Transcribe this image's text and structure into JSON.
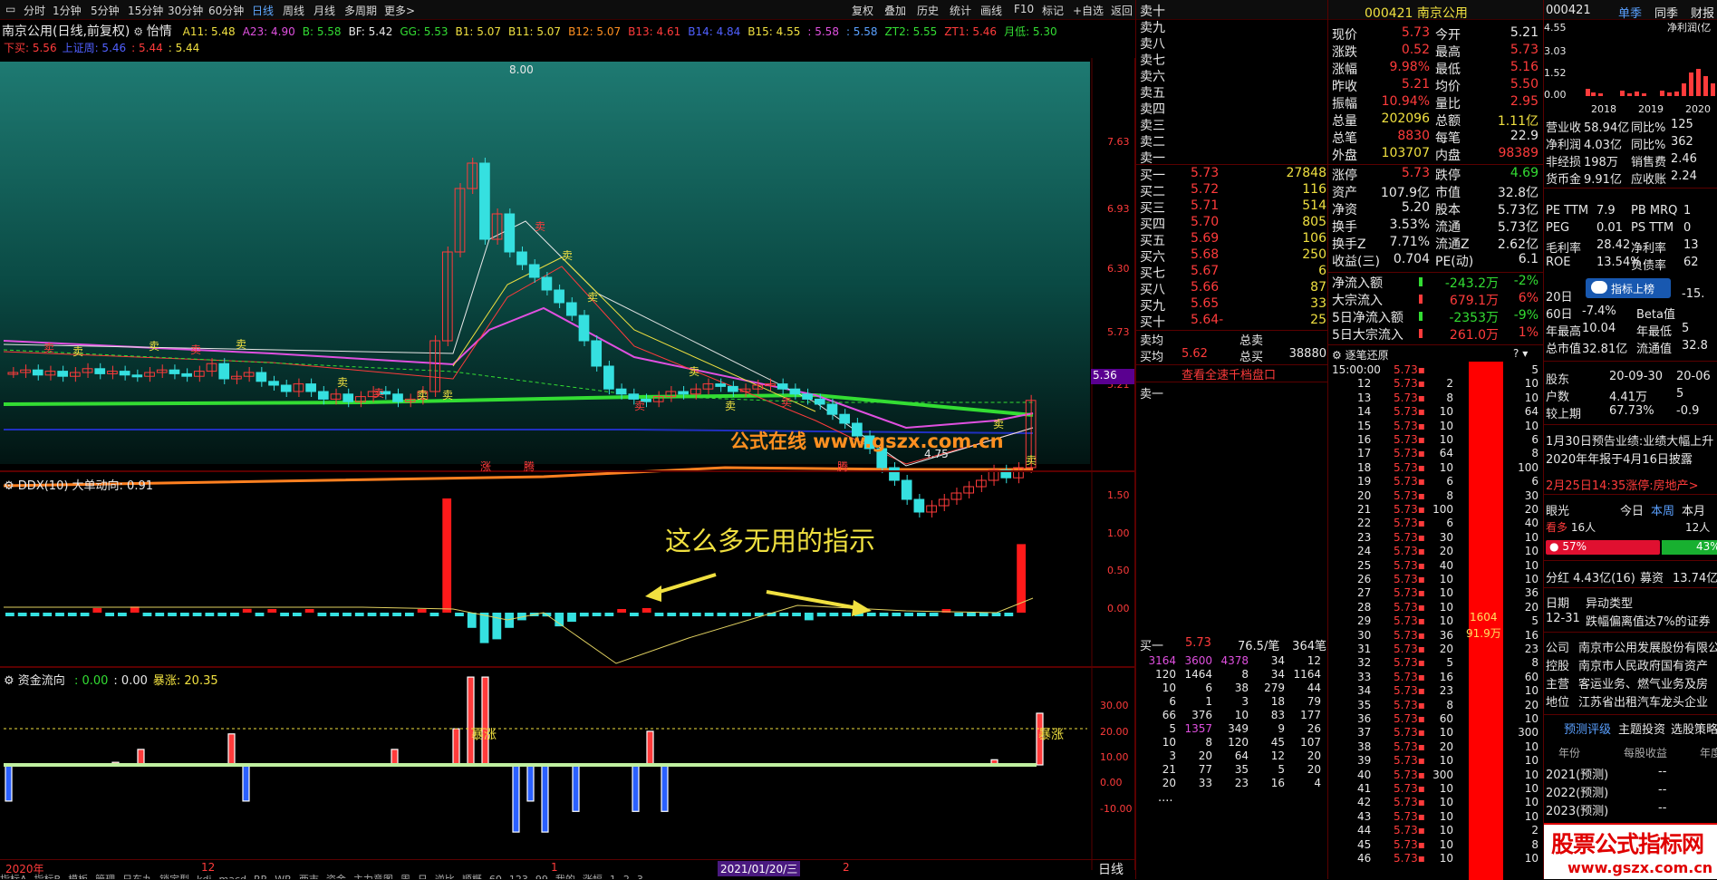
{
  "toolbar": {
    "items": [
      "分时",
      "1分钟",
      "5分钟",
      "15分钟",
      "30分钟",
      "60分钟",
      "日线",
      "周线",
      "月线",
      "多周期",
      "更多>"
    ],
    "active": "日线",
    "right": [
      "复权",
      "叠加",
      "历史",
      "统计",
      "画线",
      "F10",
      "标记",
      "+自选",
      "返回"
    ]
  },
  "chart": {
    "title": "南京公用(日线,前复权)",
    "ind_name": "怡情",
    "params": [
      {
        "t": "A11: 5.48",
        "c": "#f0e040"
      },
      {
        "t": "A23: 4.90",
        "c": "#e050e0"
      },
      {
        "t": "B: 5.58",
        "c": "#33dd33"
      },
      {
        "t": "BF: 5.42",
        "c": "#e8e8e8"
      },
      {
        "t": "GG: 5.53",
        "c": "#33dd33"
      },
      {
        "t": "B1: 5.07",
        "c": "#f0e040"
      },
      {
        "t": "B11: 5.07",
        "c": "#f0e040"
      },
      {
        "t": "B12: 5.07",
        "c": "#ff9020"
      },
      {
        "t": "B13: 4.61",
        "c": "#ff3b3b"
      },
      {
        "t": "B14: 4.84",
        "c": "#5060ff"
      },
      {
        "t": "B15: 4.55",
        "c": "#f0e040"
      },
      {
        "t": ": 5.58",
        "c": "#e050e0"
      },
      {
        "t": ": 5.58",
        "c": "#5aa0ff"
      },
      {
        "t": "ZT2: 5.55",
        "c": "#33dd33"
      },
      {
        "t": "ZT1: 5.46",
        "c": "#ff3b3b"
      },
      {
        "t": "月低: 5.30",
        "c": "#33dd33"
      }
    ],
    "line2": [
      {
        "t": "下买: 5.56",
        "c": "#ff3b3b"
      },
      {
        "t": "上证周: 5.46",
        "c": "#5060ff"
      },
      {
        "t": ": 5.44",
        "c": "#ff3b3b"
      },
      {
        "t": ": 5.44",
        "c": "#f0e040"
      }
    ],
    "yaxis": [
      "7.63",
      "6.93",
      "6.30",
      "5.73",
      "5.21"
    ],
    "current_price": "5.36",
    "high_label": "8.00",
    "low_label": "4.75",
    "watermark": "公式在线  www.gszx.com.cn",
    "bottom_marks": [
      "涨",
      "腾",
      "腾"
    ]
  },
  "ddx": {
    "title": "DDX(10) 大单动向: 0.91",
    "yaxis": [
      "1.50",
      "1.00",
      "0.50",
      "0.00"
    ],
    "annotation": "这么多无用的指示"
  },
  "fund": {
    "title": "资金流向",
    "vals": [
      {
        "t": ": 0.00",
        "c": "#33dd33"
      },
      {
        "t": ": 0.00",
        "c": "#e8e8e8"
      },
      {
        "t": "暴涨: 20.35",
        "c": "#f0e040"
      }
    ],
    "yaxis": [
      "30.00",
      "20.00",
      "10.00",
      "0.00",
      "-10.00"
    ],
    "label_baozhang": "暴涨"
  },
  "xaxis": {
    "labels": [
      "2020年",
      "12",
      "1",
      "2021/01/20/三",
      "2"
    ],
    "period": "日线"
  },
  "tabs": [
    "指标A",
    "指标B",
    "模板",
    "管理",
    "日东九",
    "锁定型",
    "kdj",
    "macd",
    "RR",
    "WR",
    "两市",
    "资金",
    "主力意图",
    "周",
    "日",
    "逆比",
    "顺概",
    "60",
    "123",
    "99",
    "我的",
    "涨幅",
    "1",
    "2",
    "3"
  ],
  "orderbook": {
    "sell": [
      "卖十",
      "卖九",
      "卖八",
      "卖七",
      "卖六",
      "卖五",
      "卖四",
      "卖三",
      "卖二",
      "卖一"
    ],
    "buy": [
      [
        "买一",
        "5.73",
        "27848"
      ],
      [
        "买二",
        "5.72",
        "116"
      ],
      [
        "买三",
        "5.71",
        "514"
      ],
      [
        "买四",
        "5.70",
        "805"
      ],
      [
        "买五",
        "5.69",
        "106"
      ],
      [
        "买六",
        "5.68",
        "250"
      ],
      [
        "买七",
        "5.67",
        "6"
      ],
      [
        "买八",
        "5.66",
        "87"
      ],
      [
        "买九",
        "5.65",
        "33"
      ],
      [
        "买十",
        "5.64-",
        "25"
      ]
    ],
    "avg_sell": "卖均",
    "total_sell": "总卖",
    "avg_buy": "买均",
    "avg_buy_val": "5.62",
    "total_buy": "总买",
    "total_buy_val": "38880",
    "link": "查看全速千档盘口",
    "sell1_label": "卖一",
    "buy1_row": [
      "买一",
      "5.73",
      "76.5/笔",
      "364笔"
    ],
    "queue": [
      [
        "3164",
        "3600",
        "4378",
        "34",
        "12"
      ],
      [
        "120",
        "1464",
        "8",
        "34",
        "1164"
      ],
      [
        "10",
        "6",
        "38",
        "279",
        "44"
      ],
      [
        "6",
        "1",
        "3",
        "18",
        "79"
      ],
      [
        "66",
        "376",
        "10",
        "83",
        "177"
      ],
      [
        "5",
        "1357",
        "349",
        "9",
        "26"
      ],
      [
        "10",
        "8",
        "120",
        "45",
        "107"
      ],
      [
        "3",
        "20",
        "64",
        "12",
        "20"
      ],
      [
        "21",
        "77",
        "35",
        "5",
        "20"
      ],
      [
        "20",
        "33",
        "23",
        "16",
        "4"
      ]
    ],
    "more": "...."
  },
  "quote": {
    "code": "000421",
    "name": "南京公用",
    "rows": [
      [
        "现价",
        "5.73",
        "今开",
        "5.21"
      ],
      [
        "涨跌",
        "0.52",
        "最高",
        "5.73"
      ],
      [
        "涨幅",
        "9.98%",
        "最低",
        "5.16"
      ],
      [
        "昨收",
        "5.21",
        "均价",
        "5.50"
      ],
      [
        "振幅",
        "10.94%",
        "量比",
        "2.95"
      ],
      [
        "总量",
        "202096",
        "总额",
        "1.11亿"
      ],
      [
        "总笔",
        "8830",
        "每笔",
        "22.9"
      ],
      [
        "外盘",
        "103707",
        "内盘",
        "98389"
      ]
    ],
    "rows2": [
      [
        "涨停",
        "5.73",
        "跌停",
        "4.69"
      ],
      [
        "资产",
        "107.9亿",
        "市值",
        "32.8亿"
      ],
      [
        "净资",
        "5.20",
        "股本",
        "5.73亿"
      ],
      [
        "换手",
        "3.53%",
        "流通",
        "5.73亿"
      ],
      [
        "换手Z",
        "7.71%",
        "流通Z",
        "2.62亿"
      ],
      [
        "收益(三)",
        "0.704",
        "PE(动)",
        "6.1"
      ]
    ],
    "flows": [
      [
        "净流入额",
        "-243.2万",
        "-2%"
      ],
      [
        "大宗流入",
        "679.1万",
        "6%"
      ],
      [
        "5日净流入额",
        "-2353万",
        "-9%"
      ],
      [
        "5日大宗流入",
        "261.0万",
        "1%"
      ]
    ]
  },
  "ticks": {
    "title": "逐笔还原",
    "q": "?",
    "start": "15:00:00",
    "mins": [
      "12",
      "13",
      "14",
      "15",
      "16",
      "17",
      "18",
      "19",
      "20",
      "21",
      "22",
      "23",
      "24",
      "25",
      "26",
      "27",
      "28",
      "29",
      "30",
      "31",
      "32",
      "33",
      "34",
      "35",
      "36",
      "37",
      "38",
      "39",
      "40",
      "41",
      "42",
      "43",
      "44",
      "45",
      "46"
    ],
    "vols": [
      "2",
      "8",
      "10",
      "10",
      "10",
      "64",
      "10",
      "6",
      "8",
      "100",
      "6",
      "30",
      "20",
      "40",
      "10",
      "10",
      "10",
      "10",
      "36",
      "20",
      "5",
      "16",
      "23",
      "8",
      "60",
      "10",
      "20",
      "10",
      "300",
      "10",
      "10",
      "10",
      "10",
      "10",
      "10"
    ],
    "vol_first": "5",
    "big_label": "1604",
    "big_label2": "91.9万",
    "price": "5.73"
  },
  "f10": {
    "code": "000421",
    "tabs": [
      "单季",
      "同季",
      "财报"
    ],
    "mini_chart": {
      "ylabels": [
        "4.55",
        "3.03",
        "1.52",
        "0.00"
      ],
      "years": [
        "2018",
        "2019",
        "2020"
      ],
      "legend": "净利润(亿"
    },
    "rows": [
      [
        "营业收",
        "58.94亿",
        "同比%",
        "125"
      ],
      [
        "净利润",
        "4.03亿",
        "同比%",
        "362"
      ],
      [
        "非经损",
        "198万",
        "销售费",
        "2.46"
      ],
      [
        "货币金",
        "9.91亿",
        "应收账",
        "2.24"
      ]
    ],
    "rows_b": [
      [
        "PE TTM",
        "7.9",
        "PB MRQ",
        "1"
      ],
      [
        "PEG",
        "0.01",
        "PS TTM",
        "0"
      ],
      [
        "毛利率",
        "28.42",
        "净利率",
        "13"
      ],
      [
        "ROE",
        "13.54%",
        "负债率",
        "62"
      ]
    ],
    "btn": "指标上榜",
    "rows_c": [
      [
        "20日",
        "",
        "",
        "-15."
      ],
      [
        "60日",
        "-7.4%",
        "Beta值",
        ""
      ],
      [
        "年最高",
        "10.04",
        "年最低",
        "5"
      ],
      [
        "总市值",
        "32.81亿",
        "流通值",
        "32.8"
      ]
    ],
    "rows_d": [
      [
        "股东",
        "20-09-30",
        "20-06"
      ],
      [
        "户数",
        "4.41万",
        "5"
      ],
      [
        "较上期",
        "67.73%",
        "-0.9"
      ]
    ],
    "news": [
      [
        "1月30日预告业绩:业绩大幅上升"
      ],
      [
        "2020年年报于4月16日披露"
      ]
    ],
    "news_red": "2月25日14:35涨停:房地产>",
    "sentiment": {
      "label": "眼光",
      "tabs": [
        "今日",
        "本周",
        "本月"
      ],
      "bull": "看多",
      "bull_n": "16人",
      "bear_n": "12人",
      "bull_pct": "57%",
      "bear_pct": "43%"
    },
    "div": [
      "分红",
      "4.43亿(16)",
      "募资",
      "13.74亿"
    ],
    "event": [
      "日期",
      "异动类型"
    ],
    "event_row": [
      "12-31",
      "跌幅偏离值达7%的证券"
    ],
    "info": [
      [
        "公司",
        "南京市公用发展股份有限公司"
      ],
      [
        "控股",
        "南京市人民政府国有资产"
      ],
      [
        "主营",
        "客运业务、燃气业务及房"
      ],
      [
        "地位",
        "江苏省出租汽车龙头企业"
      ]
    ],
    "tabs2": [
      "预测评级",
      "主题投资",
      "选股策略"
    ],
    "forecast_head": [
      "年份",
      "每股收益",
      "年度"
    ],
    "forecast": [
      [
        "2021(预测)",
        "--"
      ],
      [
        "2022(预测)",
        "--"
      ],
      [
        "2023(预测)",
        "--"
      ]
    ],
    "logo": "股票公式指标网",
    "logo_url": "www.gszx.com.cn"
  },
  "colors": {
    "up": "#ff3b3b",
    "down": "#35e0e0",
    "bg": "#000000",
    "border": "#5a0000"
  }
}
